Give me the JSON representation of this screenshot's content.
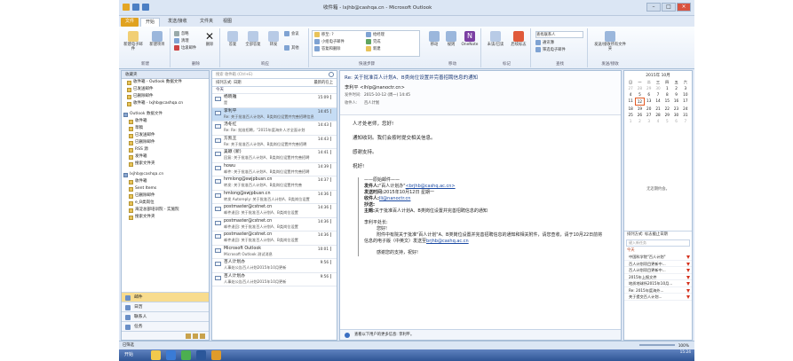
{
  "window": {
    "title": "收件箱 - lxjhb@cashqa.cn - Microsoft Outlook"
  },
  "tabs": [
    "文件",
    "开始",
    "发送/接收",
    "文件夹",
    "视图"
  ],
  "ribbon": {
    "new_email": "新建电子邮件",
    "new_items": "新建项目",
    "ignore": "忽略",
    "clean": "清理",
    "junk": "垃圾邮件",
    "delete": "删除",
    "reply": "答复",
    "reply_all": "全部答复",
    "forward": "转发",
    "meeting": "会议",
    "more": "其他",
    "qs_items": [
      "移至: ?",
      "小组电子邮件",
      "答复和删除",
      "给经理",
      "完成",
      "新建"
    ],
    "move": "移动",
    "rules": "规则",
    "onenote": "OneNote",
    "unread": "未读/已读",
    "followup": "后续标志",
    "find_contact": "查找联系人",
    "address_book": "通讯簿",
    "filter_email": "筛选电子邮件",
    "send_receive_all": "发送/接收所有文件夹",
    "group_labels": [
      "新建",
      "删除",
      "响应",
      "快速步骤",
      "移动",
      "标记",
      "查找",
      "发送/接收"
    ]
  },
  "nav": {
    "header": "收藏夹",
    "favorites": [
      "收件箱 - Outlook 数据文件",
      "已发送邮件",
      "已删除邮件",
      "收件箱 - lxjhb@cashqa.cn"
    ],
    "data_file": "Outlook 数据文件",
    "data_file_folders": [
      "收件箱",
      "草稿",
      "已发送邮件",
      "已删除邮件",
      "RSS 源",
      "发件箱",
      "搜索文件夹"
    ],
    "account": "lxjhb@cashqa.cn",
    "account_folders": [
      "收件箱",
      "Sent Items",
      "已删除邮件",
      "e_B类岗位",
      "海淀总部培训院 - 实施院",
      "搜索文件夹"
    ],
    "modules": [
      "邮件",
      "日历",
      "联系人",
      "任务"
    ]
  },
  "list": {
    "search_placeholder": "搜索 收件箱 (Ctrl+E)",
    "sort_by": "排列方式: 日期",
    "sort_order": "最新的在上",
    "today": "今天",
    "mails": [
      {
        "from": "杨晓雅",
        "subj": "是",
        "time": "15:09"
      },
      {
        "from": "李利平",
        "subj": "Re: 关于批准百人计划A、B类岗位设置并完善招聘信息",
        "time": "14:45"
      },
      {
        "from": "汤冬红",
        "subj": "Re: Re: 批准招聘，\"2015年度海外人才全面计划",
        "time": "14:43"
      },
      {
        "from": "方凯王",
        "subj": "Re: 关于批准百人计划A、B类岗位设置并完善招聘",
        "time": "14:43"
      },
      {
        "from": "吴颖 (新)",
        "subj": "回复: 关于批准百人计划A、B类岗位设置并完善招聘",
        "time": "14:41"
      },
      {
        "from": "howu",
        "subj": "邮件: 关于批准百人计划A、B类岗位设置并完善招聘",
        "time": "14:39"
      },
      {
        "from": "hrmlong@swjpbusn.cn",
        "subj": "转发: 关于批准百人计划A、B类岗位设置并完善",
        "time": "14:37"
      },
      {
        "from": "hmlong@swjpbusn.cn",
        "subj": "转发 Autoreply: 关于批准百人计划A、B类岗位设置",
        "time": "14:36"
      },
      {
        "from": "postmaster@cstnet.cn",
        "subj": "邮件退回: 关于批准百人计划A、B类岗位设置",
        "time": "14:36"
      },
      {
        "from": "postmaster@cstnet.cn",
        "subj": "邮件退回: 关于批准百人计划A、B类岗位设置",
        "time": "14:36"
      },
      {
        "from": "postmaster@cstnet.cn",
        "subj": "邮件退回: 关于批准百人计划A、B类岗位设置",
        "time": "14:36"
      },
      {
        "from": "Microsoft Outlook",
        "subj": "Microsoft Outlook 测试消息",
        "time": "10:01"
      },
      {
        "from": "百人计划办",
        "subj": "人事处公告百人计划2015年10月更新",
        "time": "9:56"
      },
      {
        "from": "百人计划办",
        "subj": "人事处公告百人计划2015年10月更新",
        "time": "9:56"
      }
    ]
  },
  "reading": {
    "subject": "Re: 关于批准百人计划A、B类岗位设置并完善招聘信息的通知",
    "from": "李利平 <lhlp@nanoctr.cn>",
    "sent_label": "发件时间:",
    "sent_value": "2015-10-12 (周一) 14:45",
    "to_label": "收件人:",
    "to_value": "百人计划",
    "body": [
      "人才处老师，您好!",
      "通知收到。我们会按时提交相关信息。",
      "感谢支持。",
      "祝好!"
    ],
    "quote_divider": "——原始邮件——",
    "quote_rows": [
      {
        "k": "发件人:",
        "v": "\"百人计划办\"",
        "link": "<brjhb@cashq.ac.cn>"
      },
      {
        "k": "发送时间:",
        "v": "2015年10月12日 星期一",
        "link": ""
      },
      {
        "k": "收件人:",
        "v": "",
        "link": "lli@nanoctr.cn"
      },
      {
        "k": "抄送:",
        "v": "",
        "link": ""
      },
      {
        "k": "主题:",
        "v": "关于批准百人计划A、B类岗位设置并完善招聘信息的通知",
        "link": ""
      }
    ],
    "quote_greeting": "李利平处长:",
    "quote_hello": "您好!",
    "quote_body": "附件中有院关于批准\"百人计划\"A、B类岗位设置并完善招聘信息的通知和相关附件，请您查收，请于10月22日前将信息的电子版（中英文）发送至",
    "quote_link": "brjhb@cashq.ac.cn",
    "quote_thanks": "感谢您的支持，祝好!",
    "footer": "查看以下用户的更多信息: 李利平。"
  },
  "todo": {
    "month": "2015年 10月",
    "weekdays": [
      "日",
      "一",
      "二",
      "三",
      "四",
      "五",
      "六"
    ],
    "days": [
      "27",
      "28",
      "29",
      "30",
      "1",
      "2",
      "3",
      "4",
      "5",
      "6",
      "7",
      "8",
      "9",
      "10",
      "11",
      "12",
      "13",
      "14",
      "15",
      "16",
      "17",
      "18",
      "19",
      "20",
      "21",
      "22",
      "23",
      "24",
      "25",
      "26",
      "27",
      "28",
      "29",
      "30",
      "31",
      "1",
      "2",
      "3",
      "4",
      "5",
      "6",
      "7"
    ],
    "today_index": 15,
    "no_appt": "无近期约会。",
    "task_header": "排列方式: 标志截止日期",
    "task_input": "键入新任务",
    "task_group": "今天",
    "tasks": [
      "中国科学院\"百人计划\"",
      "百人计划项目更新中...",
      "百人计划项目更新中...",
      "2015年上报文件",
      "地质地球所2015年10月...",
      "Re: 2015年度海外...",
      "关于提交百人计划..."
    ]
  },
  "status": {
    "left": "已筛选",
    "zoom": "100%"
  },
  "taskbar": {
    "start": "开始",
    "clock": "15:24"
  }
}
